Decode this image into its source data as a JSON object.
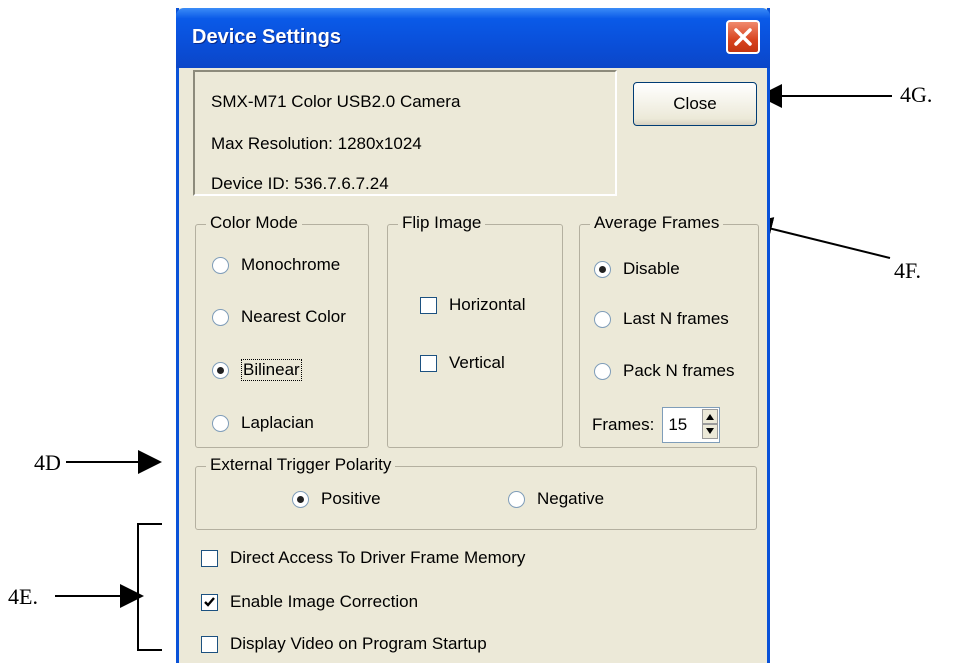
{
  "window": {
    "title": "Device Settings"
  },
  "info": {
    "camera": "SMX-M71 Color USB2.0 Camera",
    "max_resolution": "Max Resolution: 1280x1024",
    "device_id": "Device ID: 536.7.6.7.24"
  },
  "close_button": {
    "label": "Close"
  },
  "color_mode": {
    "title": "Color Mode",
    "options": [
      "Monochrome",
      "Nearest Color",
      "Bilinear",
      "Laplacian"
    ],
    "selected": "Bilinear"
  },
  "flip_image": {
    "title": "Flip Image",
    "horizontal": {
      "label": "Horizontal",
      "checked": false
    },
    "vertical": {
      "label": "Vertical",
      "checked": false
    }
  },
  "average_frames": {
    "title": "Average Frames",
    "options": [
      "Disable",
      "Last N frames",
      "Pack N frames"
    ],
    "selected": "Disable",
    "frames_label": "Frames:",
    "frames_value": "15"
  },
  "trigger": {
    "title": "External Trigger Polarity",
    "options": [
      "Positive",
      "Negative"
    ],
    "selected": "Positive"
  },
  "checkboxes": [
    {
      "label": "Direct Access To Driver Frame Memory",
      "checked": false
    },
    {
      "label": "Enable Image Correction",
      "checked": true
    },
    {
      "label": "Display Video on Program Startup",
      "checked": false
    }
  ],
  "annotations": {
    "4G": "4G.",
    "4F": "4F.",
    "4D": "4D",
    "4E": "4E."
  },
  "colors": {
    "titlebar": "#0a4fd9",
    "dialog_bg": "#ece9d8",
    "close_red": "#d8431e"
  }
}
